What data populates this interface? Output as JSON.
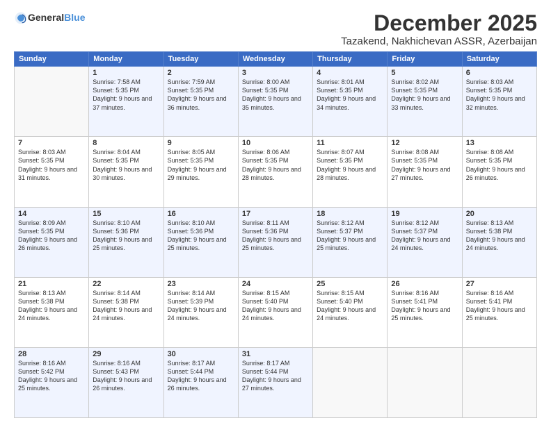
{
  "logo": {
    "general": "General",
    "blue": "Blue"
  },
  "title": "December 2025",
  "subtitle": "Tazakend, Nakhichevan ASSR, Azerbaijan",
  "weekdays": [
    "Sunday",
    "Monday",
    "Tuesday",
    "Wednesday",
    "Thursday",
    "Friday",
    "Saturday"
  ],
  "weeks": [
    [
      {
        "day": "",
        "detail": ""
      },
      {
        "day": "1",
        "detail": "Sunrise: 7:58 AM\nSunset: 5:35 PM\nDaylight: 9 hours\nand 37 minutes."
      },
      {
        "day": "2",
        "detail": "Sunrise: 7:59 AM\nSunset: 5:35 PM\nDaylight: 9 hours\nand 36 minutes."
      },
      {
        "day": "3",
        "detail": "Sunrise: 8:00 AM\nSunset: 5:35 PM\nDaylight: 9 hours\nand 35 minutes."
      },
      {
        "day": "4",
        "detail": "Sunrise: 8:01 AM\nSunset: 5:35 PM\nDaylight: 9 hours\nand 34 minutes."
      },
      {
        "day": "5",
        "detail": "Sunrise: 8:02 AM\nSunset: 5:35 PM\nDaylight: 9 hours\nand 33 minutes."
      },
      {
        "day": "6",
        "detail": "Sunrise: 8:03 AM\nSunset: 5:35 PM\nDaylight: 9 hours\nand 32 minutes."
      }
    ],
    [
      {
        "day": "7",
        "detail": "Sunrise: 8:03 AM\nSunset: 5:35 PM\nDaylight: 9 hours\nand 31 minutes."
      },
      {
        "day": "8",
        "detail": "Sunrise: 8:04 AM\nSunset: 5:35 PM\nDaylight: 9 hours\nand 30 minutes."
      },
      {
        "day": "9",
        "detail": "Sunrise: 8:05 AM\nSunset: 5:35 PM\nDaylight: 9 hours\nand 29 minutes."
      },
      {
        "day": "10",
        "detail": "Sunrise: 8:06 AM\nSunset: 5:35 PM\nDaylight: 9 hours\nand 28 minutes."
      },
      {
        "day": "11",
        "detail": "Sunrise: 8:07 AM\nSunset: 5:35 PM\nDaylight: 9 hours\nand 28 minutes."
      },
      {
        "day": "12",
        "detail": "Sunrise: 8:08 AM\nSunset: 5:35 PM\nDaylight: 9 hours\nand 27 minutes."
      },
      {
        "day": "13",
        "detail": "Sunrise: 8:08 AM\nSunset: 5:35 PM\nDaylight: 9 hours\nand 26 minutes."
      }
    ],
    [
      {
        "day": "14",
        "detail": "Sunrise: 8:09 AM\nSunset: 5:35 PM\nDaylight: 9 hours\nand 26 minutes."
      },
      {
        "day": "15",
        "detail": "Sunrise: 8:10 AM\nSunset: 5:36 PM\nDaylight: 9 hours\nand 25 minutes."
      },
      {
        "day": "16",
        "detail": "Sunrise: 8:10 AM\nSunset: 5:36 PM\nDaylight: 9 hours\nand 25 minutes."
      },
      {
        "day": "17",
        "detail": "Sunrise: 8:11 AM\nSunset: 5:36 PM\nDaylight: 9 hours\nand 25 minutes."
      },
      {
        "day": "18",
        "detail": "Sunrise: 8:12 AM\nSunset: 5:37 PM\nDaylight: 9 hours\nand 25 minutes."
      },
      {
        "day": "19",
        "detail": "Sunrise: 8:12 AM\nSunset: 5:37 PM\nDaylight: 9 hours\nand 24 minutes."
      },
      {
        "day": "20",
        "detail": "Sunrise: 8:13 AM\nSunset: 5:38 PM\nDaylight: 9 hours\nand 24 minutes."
      }
    ],
    [
      {
        "day": "21",
        "detail": "Sunrise: 8:13 AM\nSunset: 5:38 PM\nDaylight: 9 hours\nand 24 minutes."
      },
      {
        "day": "22",
        "detail": "Sunrise: 8:14 AM\nSunset: 5:38 PM\nDaylight: 9 hours\nand 24 minutes."
      },
      {
        "day": "23",
        "detail": "Sunrise: 8:14 AM\nSunset: 5:39 PM\nDaylight: 9 hours\nand 24 minutes."
      },
      {
        "day": "24",
        "detail": "Sunrise: 8:15 AM\nSunset: 5:40 PM\nDaylight: 9 hours\nand 24 minutes."
      },
      {
        "day": "25",
        "detail": "Sunrise: 8:15 AM\nSunset: 5:40 PM\nDaylight: 9 hours\nand 24 minutes."
      },
      {
        "day": "26",
        "detail": "Sunrise: 8:16 AM\nSunset: 5:41 PM\nDaylight: 9 hours\nand 25 minutes."
      },
      {
        "day": "27",
        "detail": "Sunrise: 8:16 AM\nSunset: 5:41 PM\nDaylight: 9 hours\nand 25 minutes."
      }
    ],
    [
      {
        "day": "28",
        "detail": "Sunrise: 8:16 AM\nSunset: 5:42 PM\nDaylight: 9 hours\nand 25 minutes."
      },
      {
        "day": "29",
        "detail": "Sunrise: 8:16 AM\nSunset: 5:43 PM\nDaylight: 9 hours\nand 26 minutes."
      },
      {
        "day": "30",
        "detail": "Sunrise: 8:17 AM\nSunset: 5:44 PM\nDaylight: 9 hours\nand 26 minutes."
      },
      {
        "day": "31",
        "detail": "Sunrise: 8:17 AM\nSunset: 5:44 PM\nDaylight: 9 hours\nand 27 minutes."
      },
      {
        "day": "",
        "detail": ""
      },
      {
        "day": "",
        "detail": ""
      },
      {
        "day": "",
        "detail": ""
      }
    ]
  ]
}
